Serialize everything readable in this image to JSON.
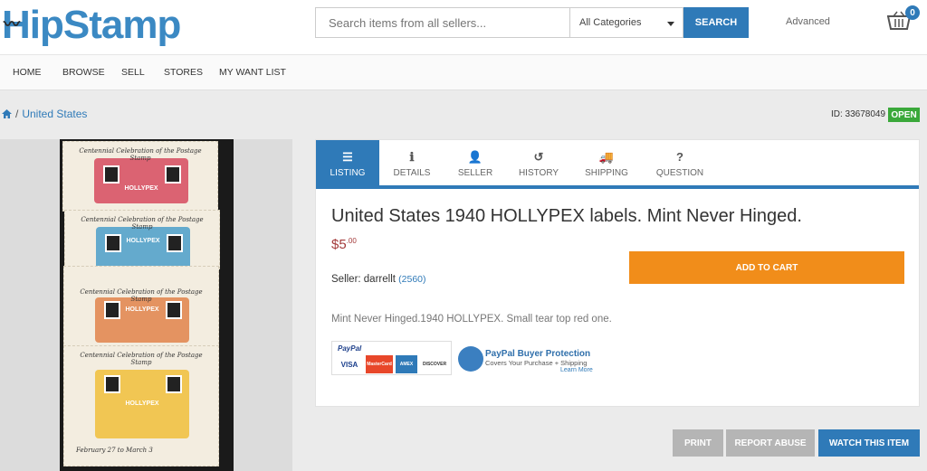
{
  "header": {
    "logo_text": "HipStamp",
    "search_placeholder": "Search items from all sellers...",
    "category_selected": "All Categories",
    "search_button": "SEARCH",
    "advanced_link": "Advanced",
    "cart_count": "0",
    "brand_color": "#3b89c3"
  },
  "nav": [
    "HOME",
    "BROWSE",
    "SELL",
    "STORES",
    "MY WANT LIST"
  ],
  "breadcrumb": {
    "home_icon": "home-icon",
    "separator": "/",
    "current": "United States"
  },
  "item": {
    "id_label": "ID: 33678049",
    "status": "OPEN",
    "title": "United States 1940 HOLLYPEX labels. Mint Never Hinged.",
    "price_main": "$5",
    "price_cents": ".00",
    "seller_label": "Seller: darrellt",
    "seller_feedback": "(2560)",
    "description": "Mint Never Hinged.1940 HOLLYPEX. Small tear top red one."
  },
  "tabs": [
    {
      "label": "LISTING",
      "icon": "list-icon",
      "glyph": "☰"
    },
    {
      "label": "DETAILS",
      "icon": "info-icon",
      "glyph": "ℹ"
    },
    {
      "label": "SELLER",
      "icon": "user-icon",
      "glyph": "👤"
    },
    {
      "label": "HISTORY",
      "icon": "history-icon",
      "glyph": "↺"
    },
    {
      "label": "SHIPPING",
      "icon": "truck-icon",
      "glyph": "🚚"
    },
    {
      "label": "QUESTION",
      "icon": "question-icon",
      "glyph": "?"
    }
  ],
  "actions": {
    "add_to_cart": "ADD TO CART",
    "print": "PRINT",
    "report": "REPORT ABUSE",
    "watch": "WATCH THIS ITEM"
  },
  "payment": {
    "paypal_label": "PayPal",
    "cards": [
      "VISA",
      "MasterCard",
      "AMEX",
      "DISCOVER"
    ],
    "protection_title": "PayPal Buyer Protection",
    "protection_sub": "Covers Your Purchase + Shipping",
    "learn_more": "Learn More"
  },
  "stamps": {
    "caption": "Centennial Celebration of the Postage Stamp",
    "banner": "HOLLYPEX",
    "footer": "February 27 to March 3",
    "colors": [
      "#d64a5e",
      "#4a9ec9",
      "#e0824a",
      "#f0be3a"
    ]
  },
  "colors": {
    "accent": "#2f7ab8",
    "cart_button": "#f18d1a",
    "open_badge": "#3aa83a",
    "price": "#a33a3a"
  }
}
